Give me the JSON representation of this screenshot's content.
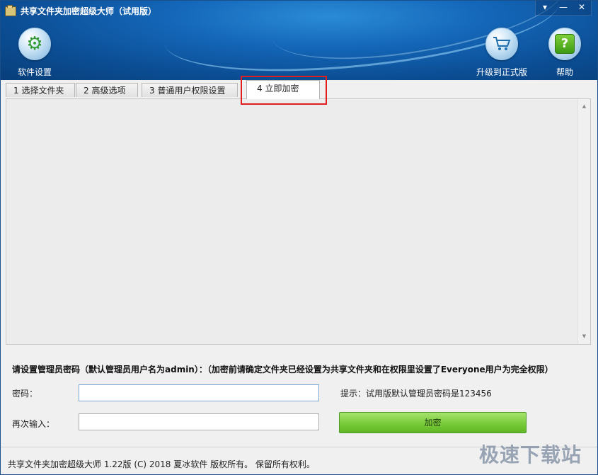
{
  "window": {
    "title": "共享文件夹加密超级大师（试用版）",
    "controls": {
      "menu": "▾",
      "minimize": "—",
      "close": "✕"
    }
  },
  "toolbar": {
    "settings": {
      "label": "软件设置",
      "icon": "gear-icon"
    },
    "upgrade": {
      "label": "升级到正式版",
      "icon": "cart-icon"
    },
    "help": {
      "label": "帮助",
      "icon": "help-icon",
      "glyph": "?"
    }
  },
  "tabs": [
    {
      "label": "1 选择文件夹",
      "active": false
    },
    {
      "label": "2 高级选项",
      "active": false
    },
    {
      "label": "3 普通用户权限设置",
      "active": false
    },
    {
      "label": "4 立即加密",
      "active": true
    }
  ],
  "form": {
    "prompt": "请设置管理员密码（默认管理员用户名为admin）：（加密前请确定文件夹已经设置为共享文件夹和在权限里设置了Everyone用户为完全权限）",
    "password_label": "密码：",
    "password_value": "",
    "confirm_label": "再次输入：",
    "confirm_value": "",
    "hint": "提示：试用版默认管理员密码是123456",
    "encrypt_button": "加密"
  },
  "status_bar": {
    "text": "共享文件夹加密超级大师 1.22版 (C) 2018 夏冰软件 版权所有。 保留所有权利。"
  },
  "watermark": "极速下载站",
  "colors": {
    "header": "#1466b8",
    "encrypt_button": "#7ccd3e",
    "highlight": "#e02020"
  }
}
